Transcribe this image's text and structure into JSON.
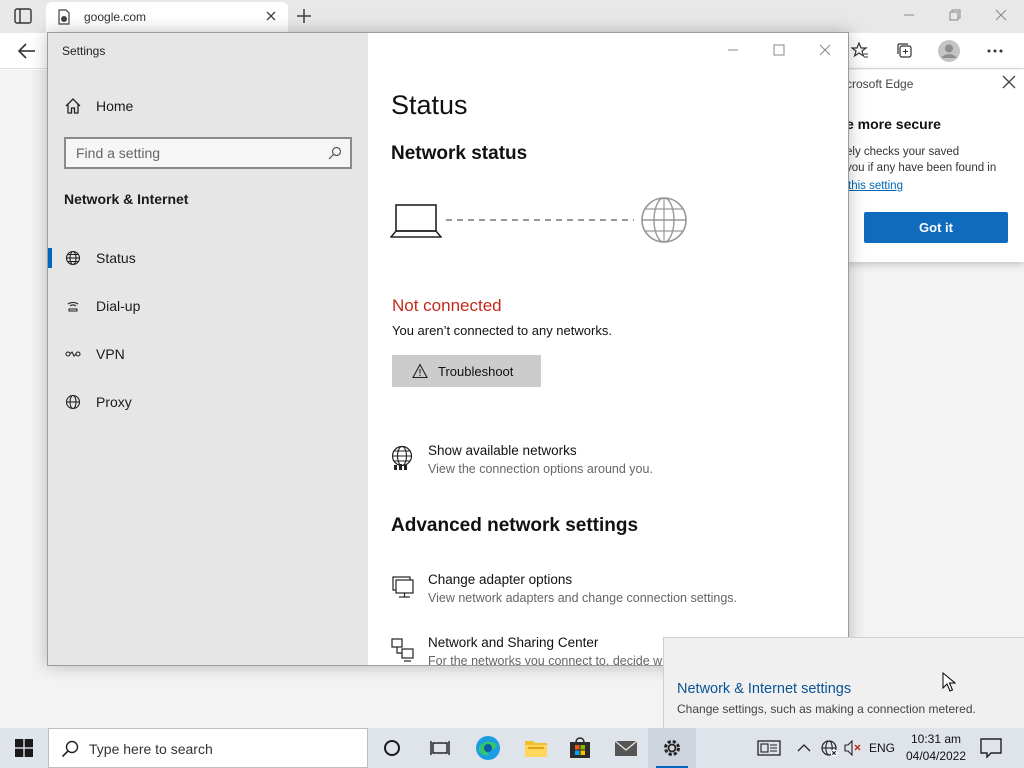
{
  "browser": {
    "tab_title": "google.com",
    "popup": {
      "header": "crosoft Edge",
      "title": "e more secure",
      "body_line1": "ely checks your saved",
      "body_line2": "you if any have been found in",
      "link": "this setting",
      "button": "Got it"
    }
  },
  "settings": {
    "app_title": "Settings",
    "home_label": "Home",
    "search_placeholder": "Find a setting",
    "section_title": "Network & Internet",
    "nav": [
      {
        "label": "Status",
        "icon": "globe-icon",
        "active": true
      },
      {
        "label": "Dial-up",
        "icon": "dialup-icon"
      },
      {
        "label": "VPN",
        "icon": "vpn-icon"
      },
      {
        "label": "Proxy",
        "icon": "globe-icon"
      }
    ],
    "main": {
      "title": "Status",
      "network_status_heading": "Network status",
      "status_text": "Not connected",
      "status_description": "You aren’t connected to any networks.",
      "troubleshoot_label": "Troubleshoot",
      "show_networks": {
        "title": "Show available networks",
        "description": "View the connection options around you."
      },
      "advanced_heading": "Advanced network settings",
      "change_adapter": {
        "title": "Change adapter options",
        "description": "View network adapters and change connection settings."
      },
      "sharing_center": {
        "title": "Network and Sharing Center",
        "description": "For the networks you connect to, decide w"
      }
    }
  },
  "flyout": {
    "title": "Network & Internet settings",
    "description": "Change settings, such as making a connection metered."
  },
  "taskbar": {
    "search_placeholder": "Type here to search",
    "language": "ENG",
    "time": "10:31 am",
    "date": "04/04/2022"
  },
  "colors": {
    "accent": "#0067c0",
    "error": "#c42b1c",
    "link": "#0b5394"
  }
}
